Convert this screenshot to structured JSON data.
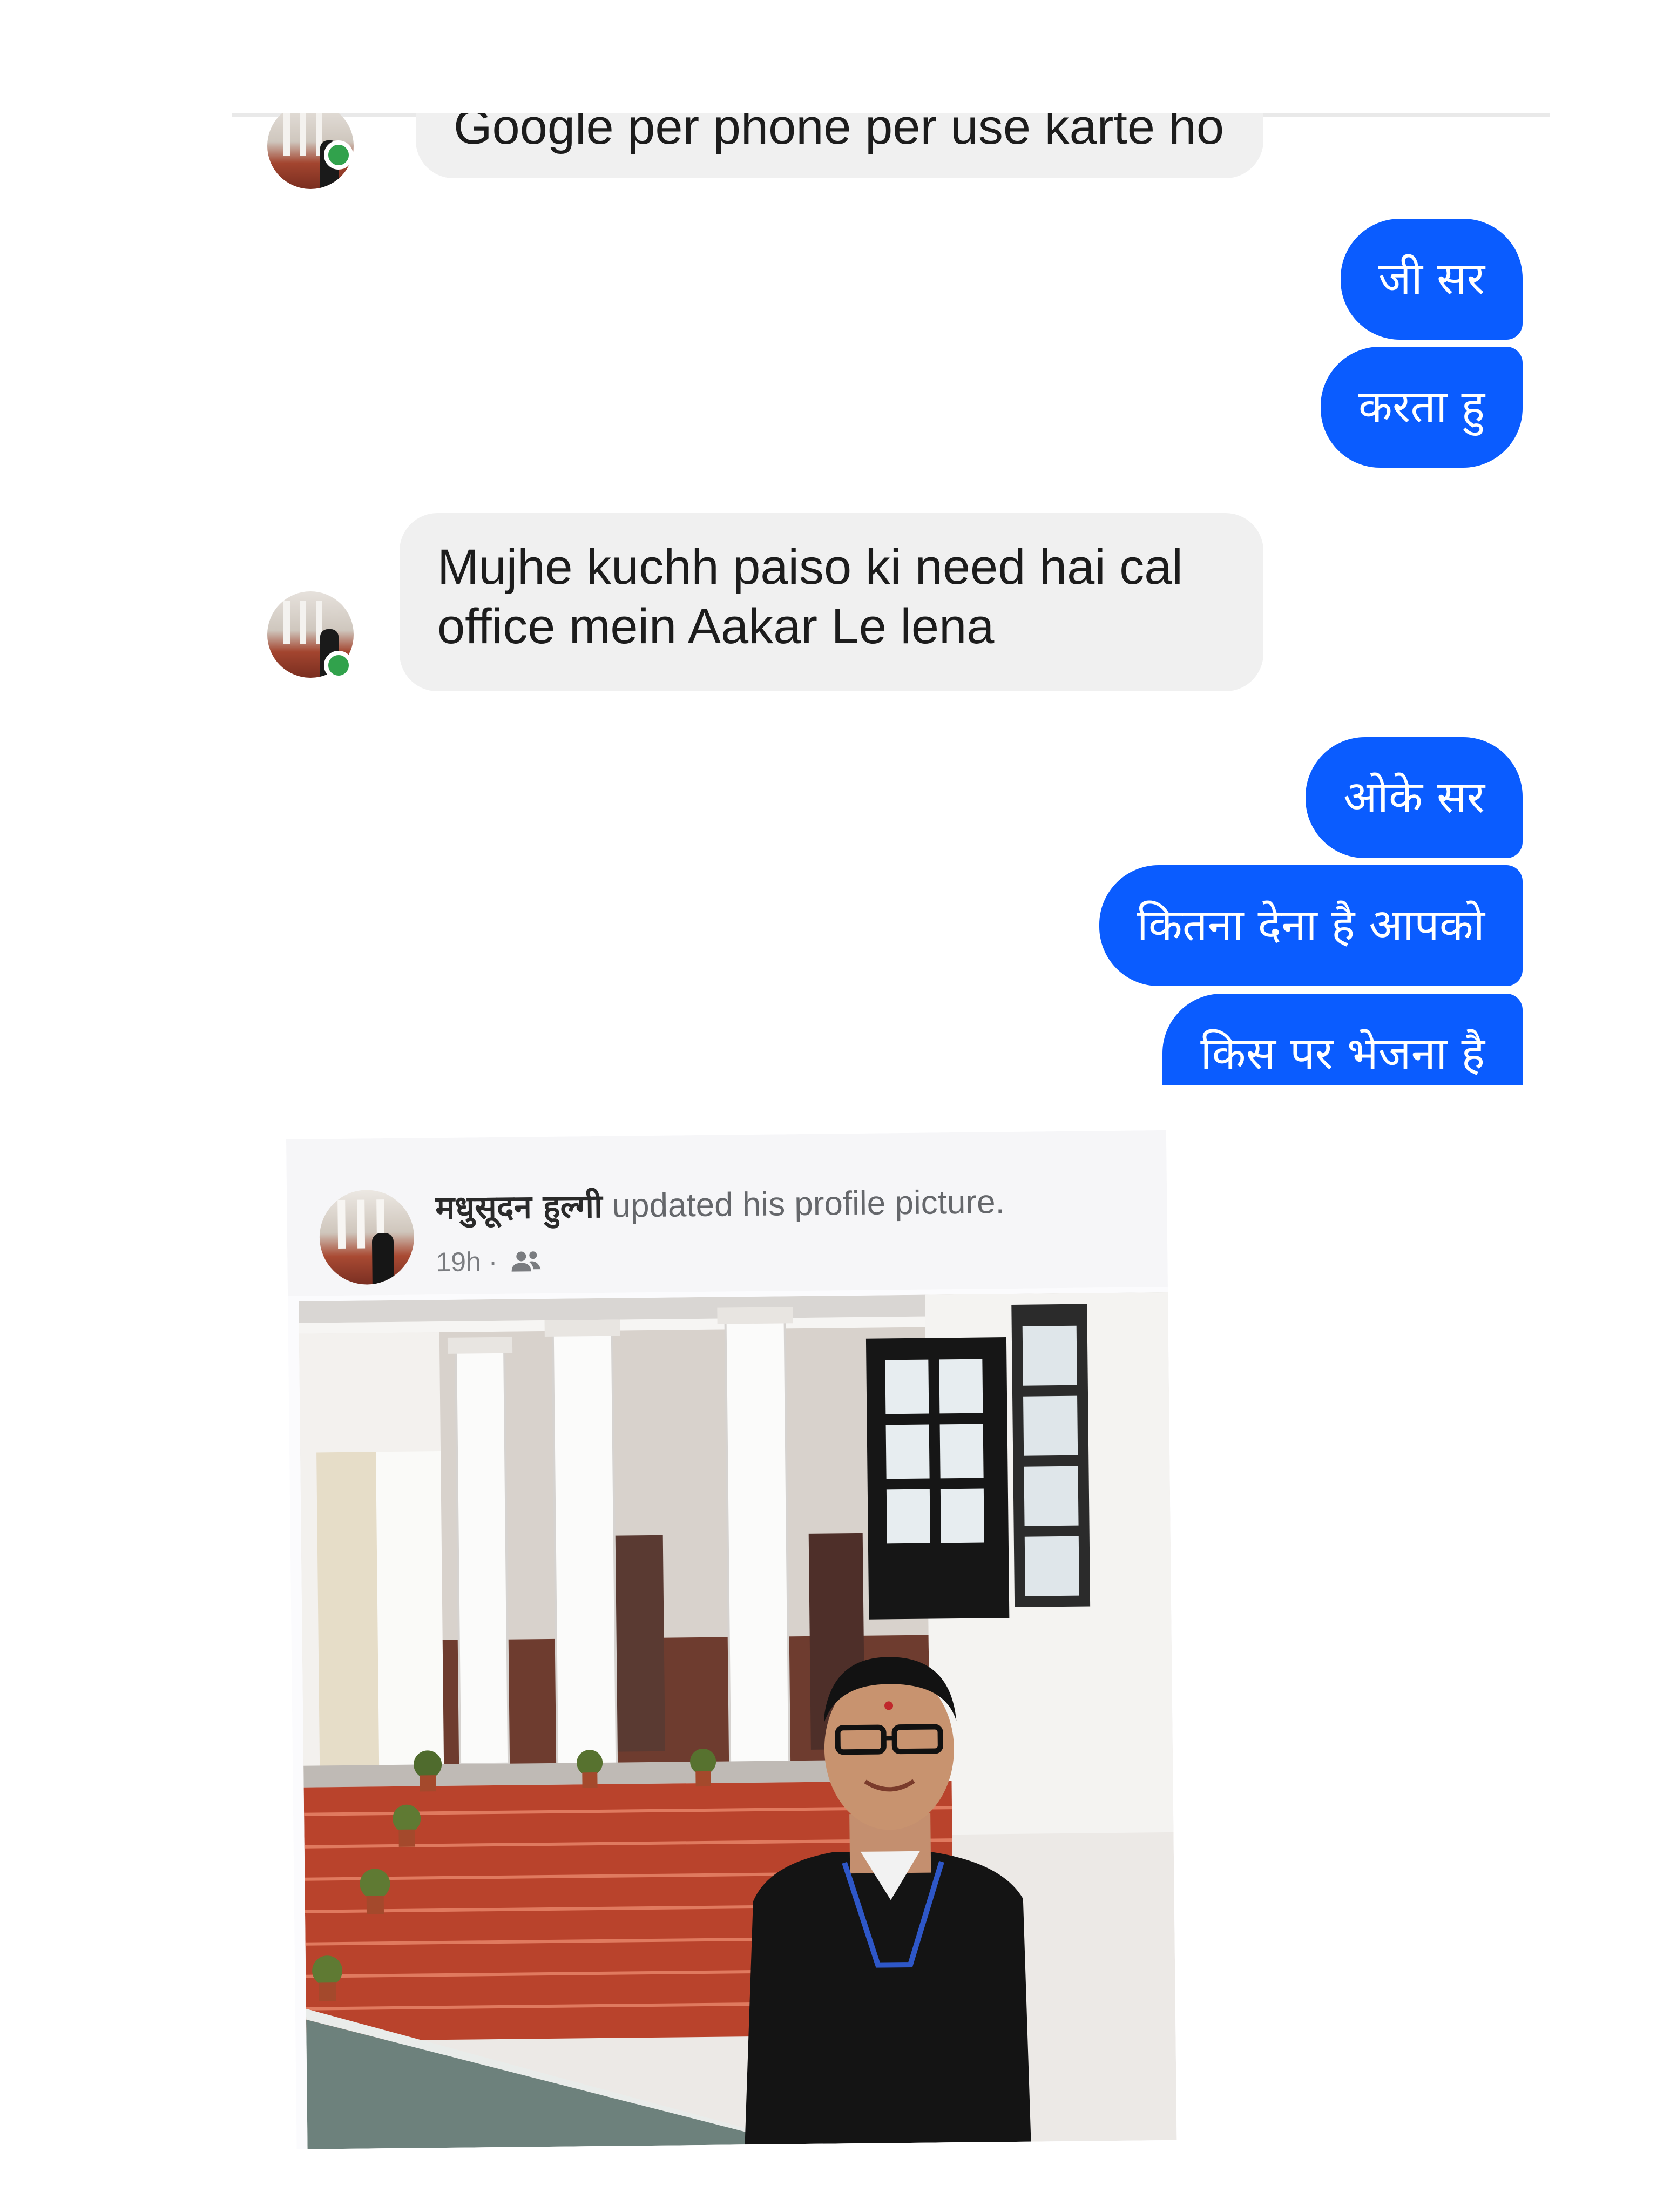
{
  "chat": {
    "messages": [
      {
        "id": "m0",
        "direction": "incoming",
        "text": "Google per phone per use karte ho"
      },
      {
        "id": "m1",
        "direction": "outgoing",
        "text": "जी सर"
      },
      {
        "id": "m2",
        "direction": "outgoing",
        "text": "करता हु"
      },
      {
        "id": "m3",
        "direction": "incoming",
        "text_line1": "Mujhe kuchh paiso ki  need hai cal",
        "text_line2": "office mein Aakar Le lena"
      },
      {
        "id": "m4",
        "direction": "outgoing",
        "text": "ओके सर"
      },
      {
        "id": "m5",
        "direction": "outgoing",
        "text": "कितना देना है आपको"
      },
      {
        "id": "m6",
        "direction": "outgoing",
        "text": "किस पर भेजना है"
      }
    ],
    "colors": {
      "outgoing_bubble": "#0a5cff",
      "incoming_bubble": "#f0f0f0",
      "online_indicator": "#31a24c"
    }
  },
  "post": {
    "author_name": "मधुसूदन हुल्गी",
    "action_text": "updated his profile picture.",
    "time": "19h ·",
    "audience_icon": "friends-icon"
  }
}
